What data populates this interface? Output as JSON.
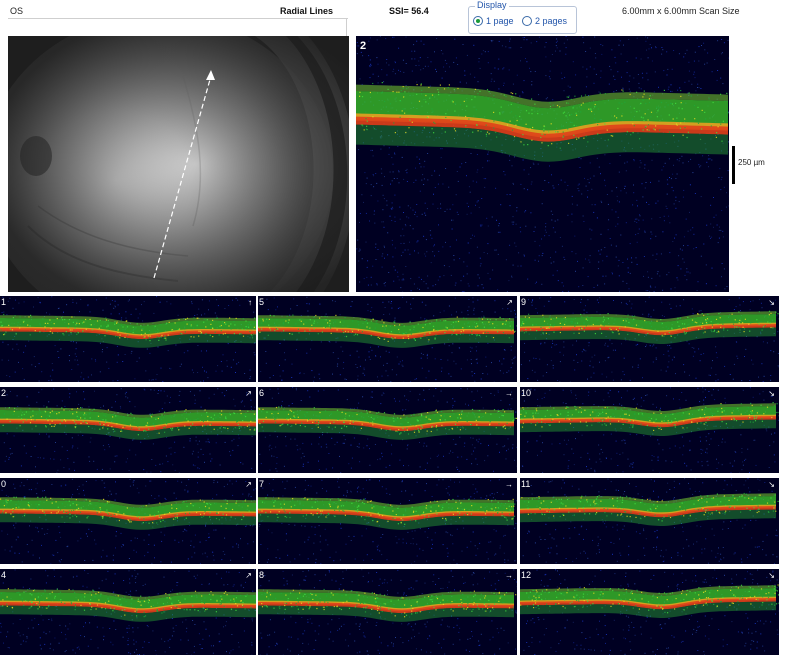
{
  "header": {
    "eye": "OS",
    "protocol": "Radial Lines",
    "ssi": "SSI=  56.4",
    "display_title": "Display",
    "display_options": [
      {
        "label": "1 page",
        "selected": true
      },
      {
        "label": "2 pages",
        "selected": false
      }
    ],
    "scan_size": "6.00mm x 6.00mm Scan Size"
  },
  "main_scan": {
    "number": "2",
    "scale_label": "250 µm"
  },
  "thumbnails": [
    {
      "number": "1",
      "arrow": "↑"
    },
    {
      "number": "5",
      "arrow": "↗"
    },
    {
      "number": "9",
      "arrow": "↘"
    },
    {
      "number": "2",
      "arrow": "↗"
    },
    {
      "number": "6",
      "arrow": "→"
    },
    {
      "number": "10",
      "arrow": "↘"
    },
    {
      "number": "0",
      "arrow": "↗"
    },
    {
      "number": "7",
      "arrow": "→"
    },
    {
      "number": "11",
      "arrow": "↘"
    },
    {
      "number": "4",
      "arrow": "↗"
    },
    {
      "number": "8",
      "arrow": "→"
    },
    {
      "number": "12",
      "arrow": "↘"
    }
  ],
  "colors": {
    "background": "#000022",
    "rnfl_green": "#3ecb2a",
    "rpe_red": "#e0401a",
    "rpe_orange": "#f0a020",
    "noise_blue": "#2a4aa8"
  }
}
